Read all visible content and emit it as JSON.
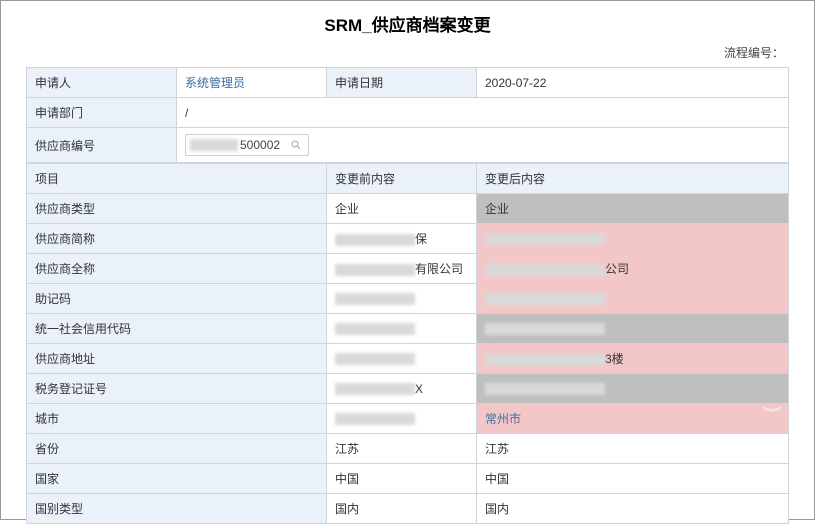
{
  "title": "SRM_供应商档案变更",
  "flow_no_label": "流程编号：",
  "top": {
    "applicant_label": "申请人",
    "applicant_value": "系统管理员",
    "apply_date_label": "申请日期",
    "apply_date_value": "2020-07-22",
    "dept_label": "申请部门",
    "dept_value": "/",
    "supplier_no_label": "供应商编号",
    "supplier_no_tail": "500002"
  },
  "cols": {
    "item": "项目",
    "before": "变更前内容",
    "after": "变更后内容"
  },
  "rows": [
    {
      "label": "供应商类型",
      "before": "企业",
      "after": "企业",
      "before_blur": false,
      "after_plain": true,
      "gray_after": true
    },
    {
      "label": "供应商简称",
      "before": "保",
      "after": "",
      "before_blur": true,
      "after_blur": true,
      "changed": true
    },
    {
      "label": "供应商全称",
      "before": "有限公司",
      "after": "公司",
      "before_blur": true,
      "after_blur_prefix": true,
      "changed": true
    },
    {
      "label": "助记码",
      "before": "",
      "after": "",
      "before_blur": true,
      "after_blur": true,
      "changed": true
    },
    {
      "label": "统一社会信用代码",
      "before": "",
      "after": "",
      "before_blur": true,
      "after_blur": true,
      "changed": false,
      "gray_after": true
    },
    {
      "label": "供应商地址",
      "before": "",
      "after": "3楼",
      "before_blur": true,
      "after_blur_prefix": true,
      "changed": true
    },
    {
      "label": "税务登记证号",
      "before": "X",
      "after": "",
      "before_blur": true,
      "after_blur": true,
      "changed": false,
      "gray_after": true
    },
    {
      "label": "城市",
      "before": "",
      "after": "常州市",
      "before_blur": true,
      "after_link": true,
      "chevron": true,
      "changed": true
    },
    {
      "label": "省份",
      "before": "江苏",
      "after": "江苏"
    },
    {
      "label": "国家",
      "before": "中国",
      "after": "中国"
    },
    {
      "label": "国别类型",
      "before": "国内",
      "after": "国内"
    }
  ]
}
